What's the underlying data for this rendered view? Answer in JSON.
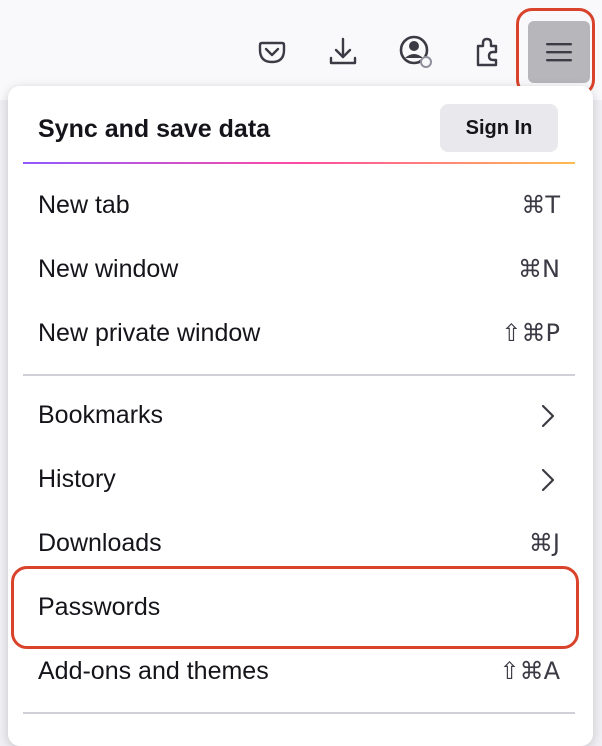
{
  "toolbar": {
    "icons": [
      "pocket-icon",
      "download-icon",
      "account-icon",
      "extensions-icon",
      "hamburger-menu-icon"
    ]
  },
  "menu": {
    "sync": {
      "title": "Sync and save data",
      "sign_in_label": "Sign In"
    },
    "items": [
      {
        "label": "New tab",
        "shortcut": "⌘T"
      },
      {
        "label": "New window",
        "shortcut": "⌘N"
      },
      {
        "label": "New private window",
        "shortcut": "⇧⌘P"
      },
      {
        "label": "Bookmarks",
        "submenu": true
      },
      {
        "label": "History",
        "submenu": true
      },
      {
        "label": "Downloads",
        "shortcut": "⌘J"
      },
      {
        "label": "Passwords"
      },
      {
        "label": "Add-ons and themes",
        "shortcut": "⇧⌘A"
      }
    ]
  },
  "colors": {
    "highlight": "#d9432c",
    "menu_button_bg": "#b6b6bb",
    "gradient": [
      "#9059ff",
      "#ff4aa2",
      "#ffbd4f"
    ]
  }
}
